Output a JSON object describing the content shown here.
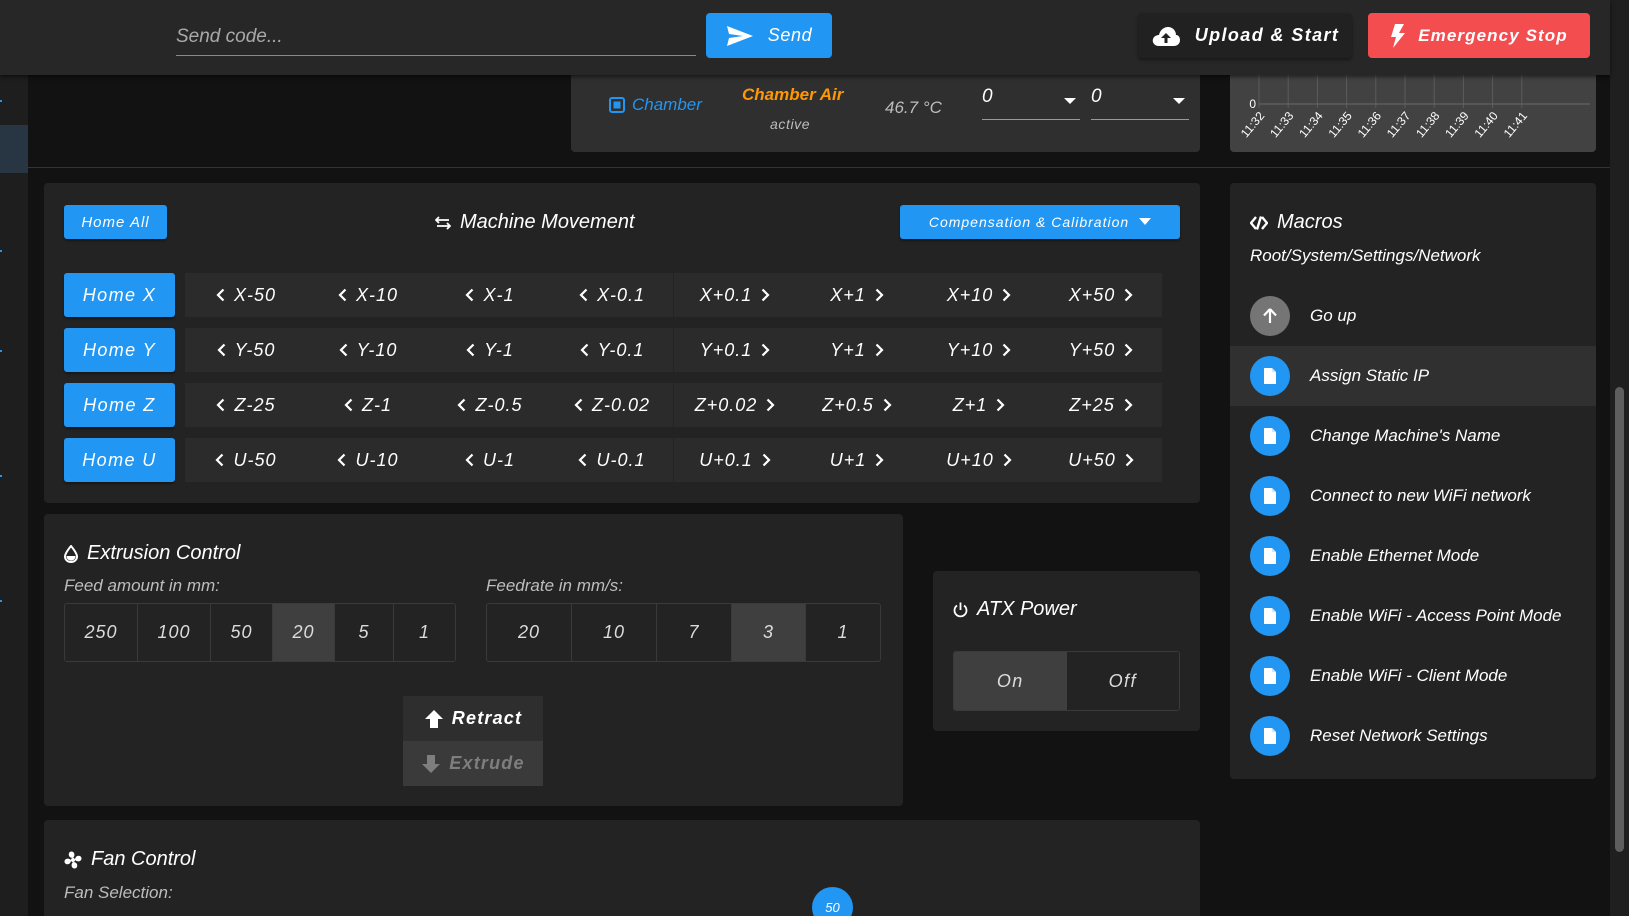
{
  "toolbar": {
    "code_placeholder": "Send code...",
    "send_label": "Send",
    "upload_label": "Upload & Start",
    "estop_label": "Emergency Stop"
  },
  "chamber": {
    "name": "Chamber",
    "heater": "Chamber Air",
    "state": "active",
    "current": "46.7 °C",
    "active_value": "0",
    "standby_value": "0"
  },
  "temp_chart": {
    "y_label": "0",
    "x_labels": [
      "11:32",
      "11:33",
      "11:34",
      "11:35",
      "11:36",
      "11:37",
      "11:38",
      "11:39",
      "11:40",
      "11:41"
    ]
  },
  "movement": {
    "home_all": "Home All",
    "title": "Machine Movement",
    "compensation": "Compensation & Calibration",
    "axes": [
      {
        "home": "Home X",
        "neg": [
          "X-50",
          "X-10",
          "X-1",
          "X-0.1"
        ],
        "pos": [
          "X+0.1",
          "X+1",
          "X+10",
          "X+50"
        ]
      },
      {
        "home": "Home Y",
        "neg": [
          "Y-50",
          "Y-10",
          "Y-1",
          "Y-0.1"
        ],
        "pos": [
          "Y+0.1",
          "Y+1",
          "Y+10",
          "Y+50"
        ]
      },
      {
        "home": "Home Z",
        "neg": [
          "Z-25",
          "Z-1",
          "Z-0.5",
          "Z-0.02"
        ],
        "pos": [
          "Z+0.02",
          "Z+0.5",
          "Z+1",
          "Z+25"
        ]
      },
      {
        "home": "Home U",
        "neg": [
          "U-50",
          "U-10",
          "U-1",
          "U-0.1"
        ],
        "pos": [
          "U+0.1",
          "U+1",
          "U+10",
          "U+50"
        ]
      }
    ]
  },
  "extrusion": {
    "title": "Extrusion Control",
    "feed_label": "Feed amount in mm:",
    "feed_options": [
      "250",
      "100",
      "50",
      "20",
      "5",
      "1"
    ],
    "feed_selected": "20",
    "rate_label": "Feedrate in mm/s:",
    "rate_options": [
      "20",
      "10",
      "7",
      "3",
      "1"
    ],
    "rate_selected": "3",
    "retract": "Retract",
    "extrude": "Extrude"
  },
  "atx": {
    "title": "ATX Power",
    "on": "On",
    "off": "Off",
    "selected": "On"
  },
  "fan": {
    "title": "Fan Control",
    "selection_label": "Fan Selection:",
    "value": "50"
  },
  "macros": {
    "title": "Macros",
    "path": "Root/System/Settings/Network",
    "items": [
      {
        "label": "Go up",
        "icon": "arrow-up-icon"
      },
      {
        "label": "Assign Static IP",
        "icon": "file-icon"
      },
      {
        "label": "Change Machine's Name",
        "icon": "file-icon"
      },
      {
        "label": "Connect to new WiFi network",
        "icon": "file-icon"
      },
      {
        "label": "Enable Ethernet Mode",
        "icon": "file-icon"
      },
      {
        "label": "Enable WiFi - Access Point Mode",
        "icon": "file-icon"
      },
      {
        "label": "Enable WiFi - Client Mode",
        "icon": "file-icon"
      },
      {
        "label": "Reset Network Settings",
        "icon": "file-icon"
      }
    ],
    "highlighted_index": 1
  },
  "colors": {
    "accent": "#2196f3",
    "danger": "#f44d50",
    "heater": "#ff9800"
  }
}
